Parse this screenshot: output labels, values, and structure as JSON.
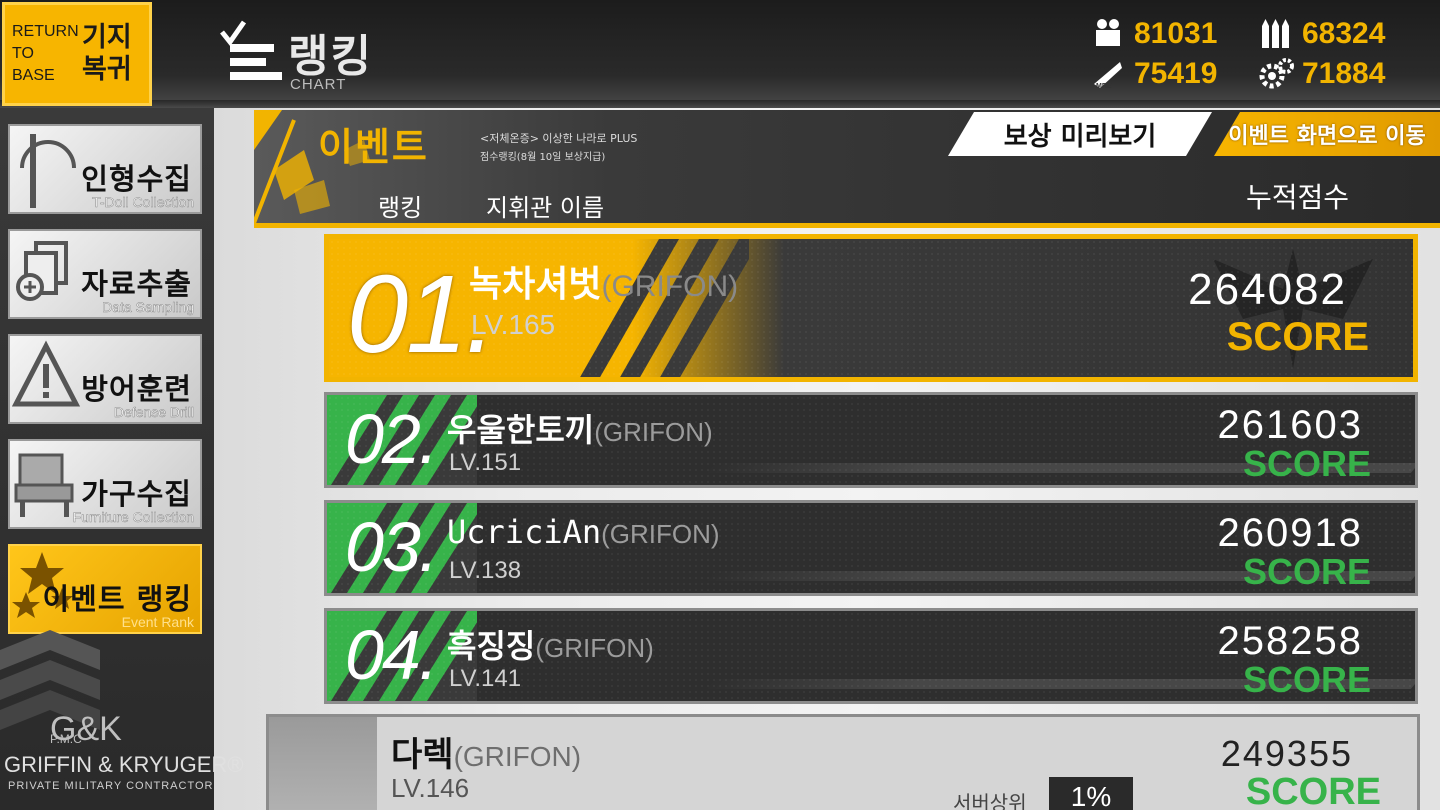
{
  "return_button": {
    "en": "RETURN TO BASE",
    "kr": "기지 복귀"
  },
  "header": {
    "title": "랭킹",
    "subtitle": "CHART"
  },
  "resources": [
    {
      "icon": "manpower-icon",
      "value": "81031"
    },
    {
      "icon": "ammo-icon",
      "value": "68324"
    },
    {
      "icon": "rations-icon",
      "value": "75419"
    },
    {
      "icon": "parts-icon",
      "value": "71884"
    }
  ],
  "sidebar": {
    "items": [
      {
        "kr": "인형수집",
        "en": "T-Doll Collection",
        "icon": "tdoll-icon"
      },
      {
        "kr": "자료추출",
        "en": "Data Sampling",
        "icon": "data-icon"
      },
      {
        "kr": "방어훈련",
        "en": "Defense Drill",
        "icon": "warning-icon"
      },
      {
        "kr": "가구수집",
        "en": "Furniture Collection",
        "icon": "chair-icon"
      },
      {
        "kr": "이벤트 랭킹",
        "en": "Event Rank",
        "icon": "star-icon"
      }
    ],
    "logo": {
      "top": "G&K",
      "pmc": "P.M.C",
      "name": "GRIFFIN & KRYUGER®",
      "sub": "PRIVATE MILITARY CONTRACTOR"
    }
  },
  "event": {
    "title": "이벤트",
    "desc1": "<저체온증> 이상한 나라로 PLUS",
    "desc2": "점수랭킹(8월 10일 보상지급)",
    "reward_button": "보상 미리보기",
    "go_button": "이벤트 화면으로 이동",
    "col_rank": "랭킹",
    "col_name": "지휘관 이름",
    "col_score": "누적점수"
  },
  "rows": [
    {
      "rank": "01.",
      "name": "녹차셔벗",
      "guild": "(GRIFON)",
      "lv": "LV.165",
      "score": "264082",
      "score_label": "SCORE"
    },
    {
      "rank": "02.",
      "name": "우울한토끼",
      "guild": "(GRIFON)",
      "lv": "LV.151",
      "score": "261603",
      "score_label": "SCORE"
    },
    {
      "rank": "03.",
      "name": "UcriciAn",
      "guild": "(GRIFON)",
      "lv": "LV.138",
      "score": "260918",
      "score_label": "SCORE"
    },
    {
      "rank": "04.",
      "name": "흑징징",
      "guild": "(GRIFON)",
      "lv": "LV.141",
      "score": "258258",
      "score_label": "SCORE"
    }
  ],
  "self_row": {
    "name": "다렉",
    "guild": "(GRIFON)",
    "lv": "LV.146",
    "score": "249355",
    "score_label": "SCORE",
    "server_label": "서버상위",
    "percent": "1%"
  },
  "colors": {
    "accent": "#f2b400",
    "green": "#37b34a",
    "dark": "#2e2e2e"
  }
}
